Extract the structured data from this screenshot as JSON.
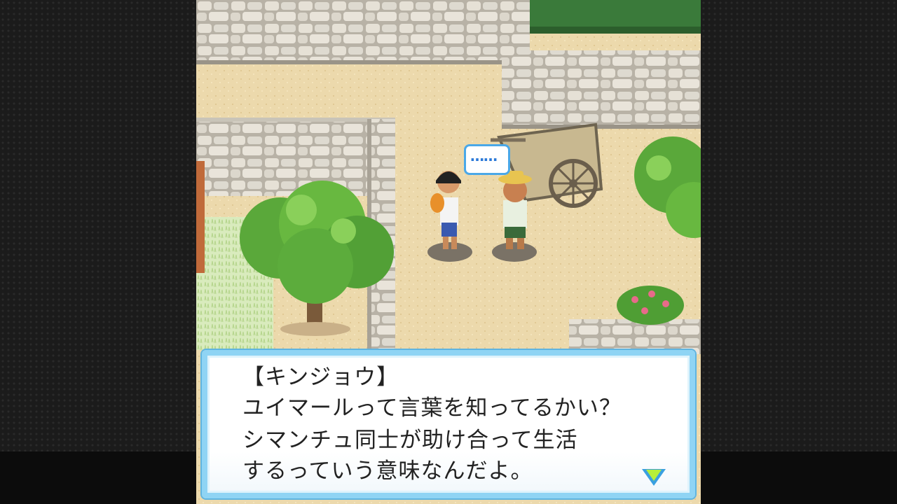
{
  "dialog": {
    "speaker": "【キンジョウ】",
    "lines": [
      "ユイマールって言葉を知ってるかい？",
      "シマンチュ同士が助け合って生活",
      "するっていう意味なんだよ。"
    ]
  },
  "speech_bubble": {
    "text": "……"
  },
  "colors": {
    "dialog_border": "#8fd4f4",
    "dialog_bg": "#ffffff",
    "ground": "#e8d4a6",
    "stone_wall": "#d8d3c8",
    "foliage": "#5aa83a"
  },
  "icons": [
    "advance-arrow-icon",
    "speech-bubble-icon"
  ]
}
